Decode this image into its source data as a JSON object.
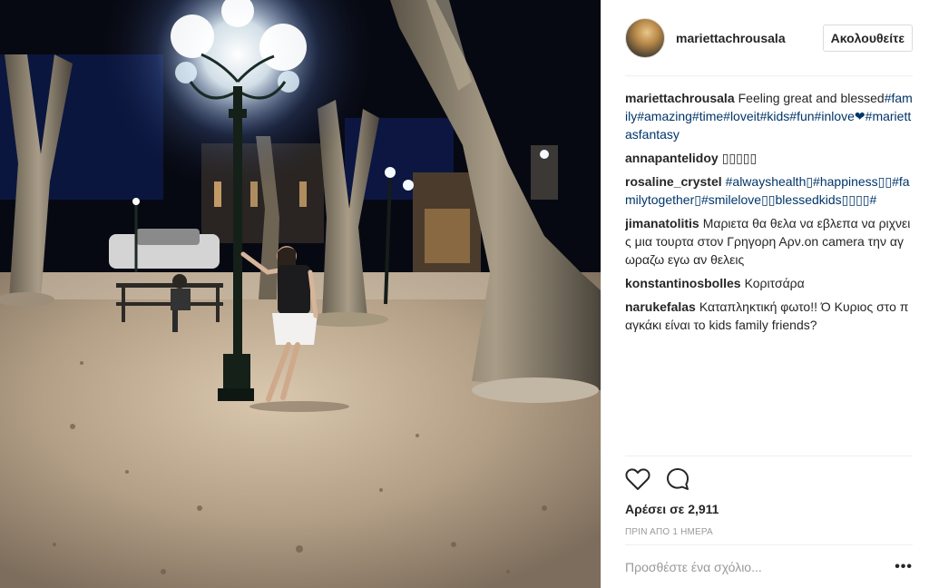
{
  "post": {
    "username": "mariettachrousala",
    "follow_label": "Ακολουθείτε",
    "caption": {
      "user": "mariettachrousala",
      "text": "Feeling great and blessed",
      "hashtags": "#family#amazing#time#loveit#kids#fun#inlove❤#mariettasfantasy"
    },
    "comments": [
      {
        "user": "annapantelidoy",
        "text": "",
        "tags": "▯▯▯▯▯"
      },
      {
        "user": "rosaline_crystel",
        "text": "",
        "tags": "#alwayshealth▯#happiness▯▯#familytogether▯#smilelove▯▯blessedkids▯▯▯▯#"
      },
      {
        "user": "jimanatolitis",
        "text": "Μαριετα θα θελα να εβλεπα να ριχνεις μια τουρτα στον Γρηγορη Αρν.on camera την αγωραζω εγω αν θελεις",
        "tags": ""
      },
      {
        "user": "konstantinosbolles",
        "text": "Κοριτσάρα",
        "tags": ""
      },
      {
        "user": "narukefalas",
        "text": "Καταπληκτική φωτο!! Ό Κυριος στο παγκάκι είναι το kids family friends?",
        "tags": ""
      }
    ],
    "likes": "Αρέσει σε 2,911",
    "timestamp": "ΠΡΙΝ ΑΠΟ 1 ΗΜΕΡΑ",
    "add_comment_placeholder": "Προσθέστε ένα σχόλιο...",
    "more_label": "•••"
  },
  "icons": {
    "like": "heart-outline-icon",
    "comment": "speech-bubble-icon",
    "more": "ellipsis-icon"
  },
  "colors": {
    "hashtag": "#003569",
    "muted": "#999999",
    "text": "#262626",
    "divider": "#efefef"
  }
}
